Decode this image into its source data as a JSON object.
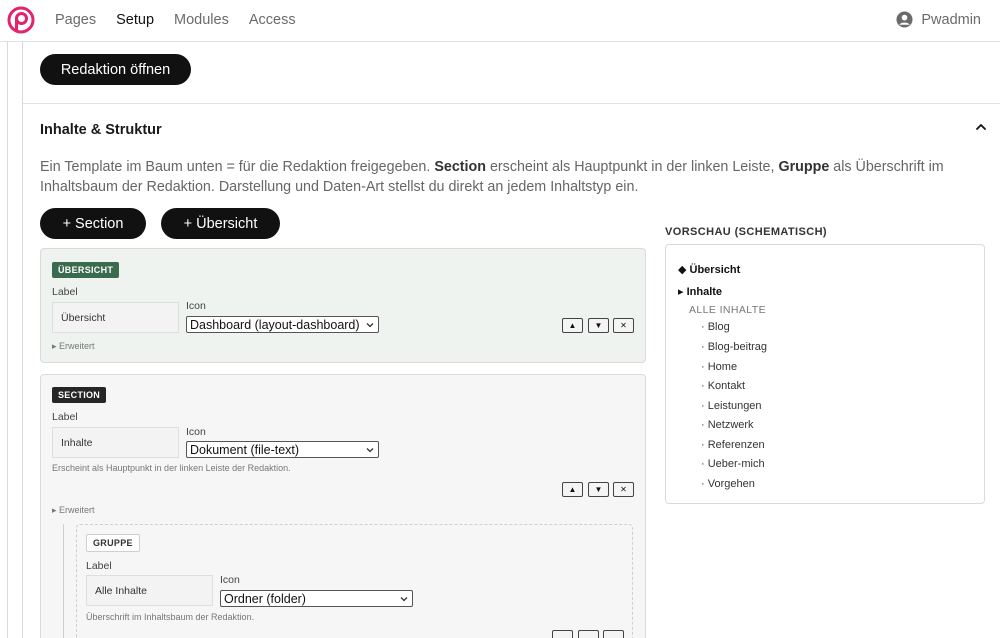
{
  "nav": {
    "items": [
      {
        "label": "Pages",
        "active": false
      },
      {
        "label": "Setup",
        "active": true
      },
      {
        "label": "Modules",
        "active": false
      },
      {
        "label": "Access",
        "active": false
      }
    ],
    "user": "Pwadmin"
  },
  "colors": {
    "brand": "#e2236d",
    "green_badge": "#3b6b4e",
    "green_card": "#eef3ef"
  },
  "actions": {
    "open_editor": "Redaktion öffnen"
  },
  "section": {
    "title": "Inhalte & Struktur",
    "desc_1": "Ein Template im Baum unten = für die Redaktion freigegeben. ",
    "desc_section": "Section",
    "desc_2": " erscheint als Hauptpunkt in der linken Leiste, ",
    "desc_group": "Gruppe",
    "desc_3": " als Überschrift im Inhaltsbaum der Redaktion. Darstellung und Daten-Art stellst du direkt an jedem Inhaltstyp ein.",
    "add_section": "+ Section",
    "add_overview": "+ Übersicht"
  },
  "common": {
    "label": "Label",
    "icon": "Icon",
    "advanced": "▸ Erweitert",
    "up": "▲",
    "down": "▼",
    "remove": "✕"
  },
  "cards": {
    "overview": {
      "badge": "ÜBERSICHT",
      "label_value": "Übersicht",
      "icon_value": "Dashboard (layout-dashboard)"
    },
    "section": {
      "badge": "SECTION",
      "label_value": "Inhalte",
      "icon_value": "Dokument (file-text)",
      "help": "Erscheint als Hauptpunkt in der linken Leiste der Redaktion."
    },
    "group": {
      "badge": "GRUPPE",
      "label_value": "Alle Inhalte",
      "icon_value": "Ordner (folder)",
      "help": "Überschrift im Inhaltsbaum der Redaktion."
    }
  },
  "preview": {
    "title": "VORSCHAU (SCHEMATISCH)",
    "overview": "◆ Übersicht",
    "section": "▸ Inhalte",
    "group": "ALLE INHALTE",
    "items": [
      "· Blog",
      "· Blog-beitrag",
      "· Home",
      "· Kontakt",
      "· Leistungen",
      "· Netzwerk",
      "· Referenzen",
      "· Ueber-mich",
      "· Vorgehen"
    ]
  }
}
